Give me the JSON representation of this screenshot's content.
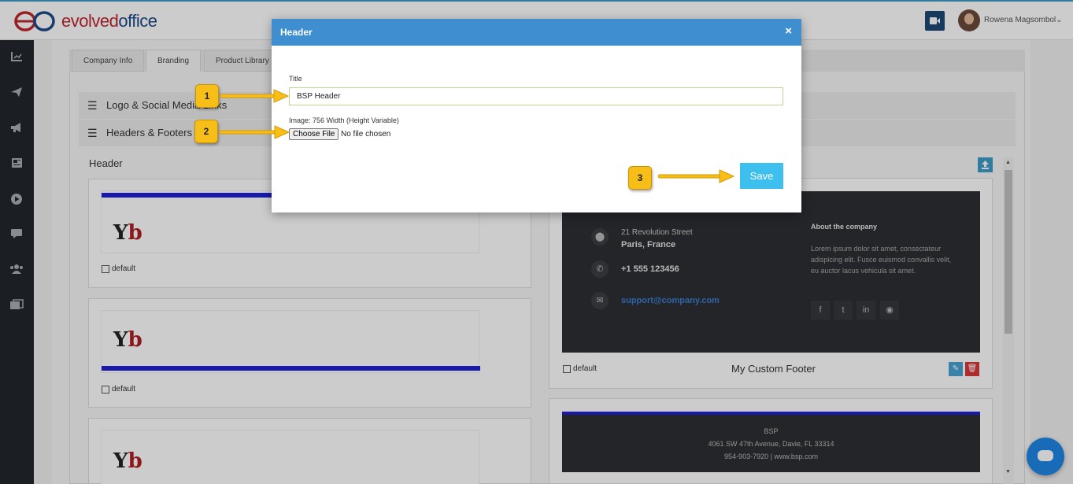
{
  "app": {
    "logo_part1": "evolved",
    "logo_part2": "office",
    "user_name": "Rowena Magsombol"
  },
  "sidebar": {
    "icons": [
      "chart-icon",
      "send-icon",
      "megaphone-icon",
      "newspaper-icon",
      "play-icon",
      "chat-icon",
      "users-icon",
      "gallery-icon"
    ]
  },
  "tabs": [
    {
      "label": "Company Info"
    },
    {
      "label": "Branding"
    },
    {
      "label": "Product Library"
    }
  ],
  "sections": {
    "logo_social": "Logo & Social Media Links",
    "headers_footers": "Headers & Footers",
    "header_title": "Header",
    "default_label": "default"
  },
  "footer_preview": {
    "address_line1": "21 Revolution Street",
    "address_line2": "Paris, France",
    "phone": "+1 555 123456",
    "email": "support@company.com",
    "about_title": "About the company",
    "about_text": "Lorem ipsum dolor sit amet, consectateur adispicing elit. Fusce euismod convallis velit, eu auctor lacus vehicula sit amet.",
    "name": "My Custom Footer"
  },
  "footer_preview2": {
    "company": "BSP",
    "address": "4061 SW 47th Avenue, Davie, FL 33314",
    "contact": "954-903-7920 | www.bsp.com"
  },
  "modal": {
    "title": "Header",
    "close": "×",
    "title_label": "Title",
    "title_value": "BSP Header",
    "image_label": "Image: 756 Width (Height Variable)",
    "choose_file": "Choose File",
    "file_status": "No file chosen",
    "save": "Save"
  },
  "annotations": [
    "1",
    "2",
    "3"
  ],
  "colors": {
    "modal_header": "#3f8fd0",
    "save_button": "#3ec0ee",
    "badge": "#f7be18",
    "accent": "#1f1fd6"
  }
}
